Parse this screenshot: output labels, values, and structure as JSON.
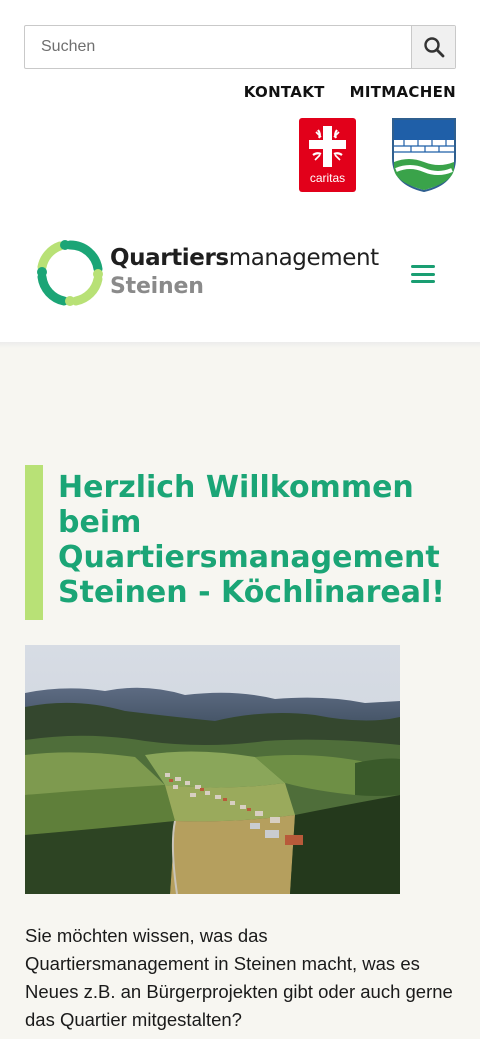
{
  "search": {
    "placeholder": "Suchen",
    "icon": "search-icon"
  },
  "toplinks": {
    "kontakt": "KONTAKT",
    "mitmachen": "MITMACHEN"
  },
  "partners": {
    "caritas_label": "caritas"
  },
  "logo": {
    "title_bold": "Quartiers",
    "title_regular": "management",
    "subtitle": "Steinen"
  },
  "menu": {
    "icon": "hamburger-menu-icon"
  },
  "colors": {
    "accent_green": "#1ba576",
    "bar_lime": "#b8e176",
    "caritas_red": "#e2001a",
    "content_bg": "#f7f6f1"
  },
  "main": {
    "headline": "Herzlich Willkommen beim Quartiersmanagement Steinen - Köchlinareal!",
    "intro": "Sie möchten wissen, was das Quartiersmanagement in Steinen macht, was es Neues z.B. an Bürgerprojekten gibt oder auch gerne das Quartier mitgestalten?"
  }
}
